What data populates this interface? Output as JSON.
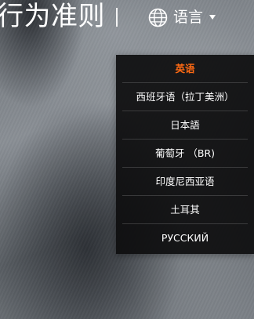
{
  "header": {
    "title": "行为准则",
    "language_button_label": "语言"
  },
  "language_menu": {
    "items": [
      {
        "label": "英语",
        "active": true
      },
      {
        "label": "西班牙语（拉丁美洲）",
        "active": false
      },
      {
        "label": "日本語",
        "active": false
      },
      {
        "label": "葡萄牙 （BR)",
        "active": false
      },
      {
        "label": "印度尼西亚语",
        "active": false
      },
      {
        "label": "土耳其",
        "active": false
      },
      {
        "label": "РУССКИЙ",
        "active": false
      }
    ]
  },
  "colors": {
    "active_item": "#ff6a13",
    "menu_background": "#0e0e0f",
    "text": "#ffffff"
  },
  "icons": {
    "language": "globe-icon",
    "dropdown": "caret-down-icon"
  }
}
